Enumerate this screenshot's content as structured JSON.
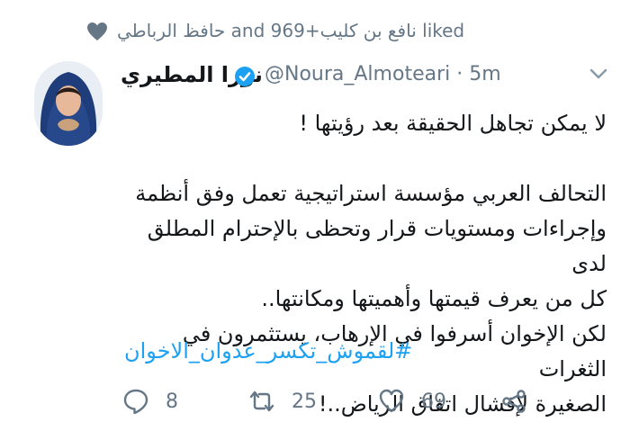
{
  "liked_line": "حافظ الرباطي and نافع بن كليب+969 liked",
  "user": {
    "display_name": "نورا المطيري",
    "handle_time": "@Noura_Almoteari · 5m"
  },
  "tweet": {
    "body": "لا يمكن تجاهل الحقيقة بعد رؤيتها !\n\nالتحالف العربي مؤسسة استراتيجية تعمل وفق أنظمة\nوإجراءات ومستويات قرار وتحظى بالإحترام المطلق لدى\nكل من يعرف قيمتها وأهميتها ومكانتها..\nلكن الإخوان أسرفوا في الإرهاب، يستثمرون في الثغرات\nالصغيرة لإفشال اتفاق الرياض..!",
    "hashtag": "#لقموش_تكسر_عدوان_الاخوان"
  },
  "actions": {
    "reply_count": "8",
    "retweet_count": "25",
    "like_count": "69"
  },
  "colors": {
    "accent": "#1da1f2",
    "verified": "#1da1f2",
    "muted": "#657786"
  },
  "icons": [
    "heart-icon",
    "verified-icon",
    "chevron-down-icon",
    "reply-icon",
    "retweet-icon",
    "like-icon",
    "share-icon"
  ]
}
